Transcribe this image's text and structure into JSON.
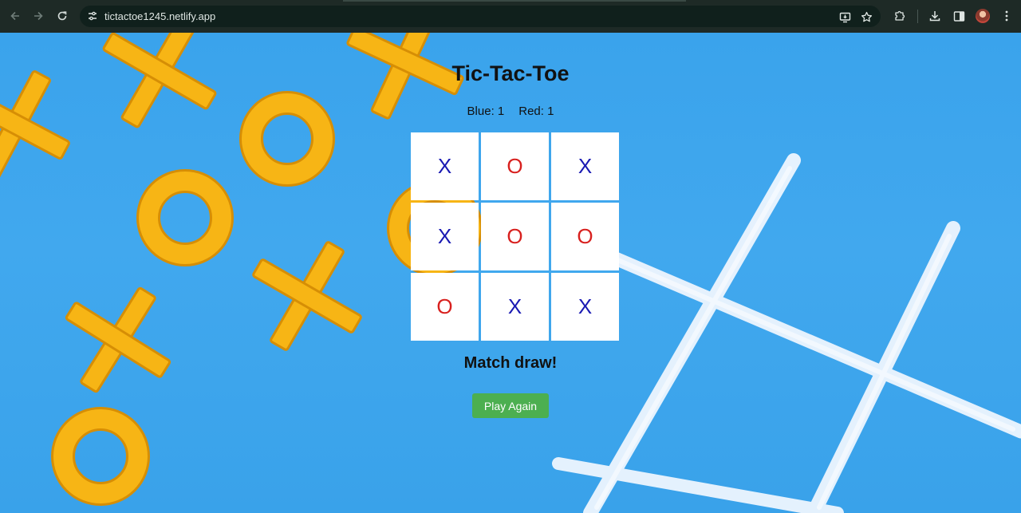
{
  "browser": {
    "url": "tictactoe1245.netlify.app",
    "icons": {
      "back": "arrow-left-icon",
      "forward": "arrow-right-icon",
      "reload": "reload-icon",
      "site_settings": "tune-icon",
      "install": "install-app-icon",
      "bookmark": "star-icon",
      "extensions": "puzzle-icon",
      "downloads": "download-icon",
      "side_panel": "side-panel-icon",
      "menu": "kebab-menu-icon"
    }
  },
  "game": {
    "title": "Tic-Tac-Toe",
    "score_blue": "Blue: 1",
    "score_red": "Red: 1",
    "board": [
      [
        "X",
        "O",
        "X"
      ],
      [
        "X",
        "O",
        "O"
      ],
      [
        "O",
        "X",
        "X"
      ]
    ],
    "result": "Match draw!",
    "play_again_label": "Play Again"
  },
  "colors": {
    "x_mark": "#1a1ab3",
    "o_mark": "#d8201e",
    "button": "#4caf50",
    "background": "#3aa3ec"
  }
}
